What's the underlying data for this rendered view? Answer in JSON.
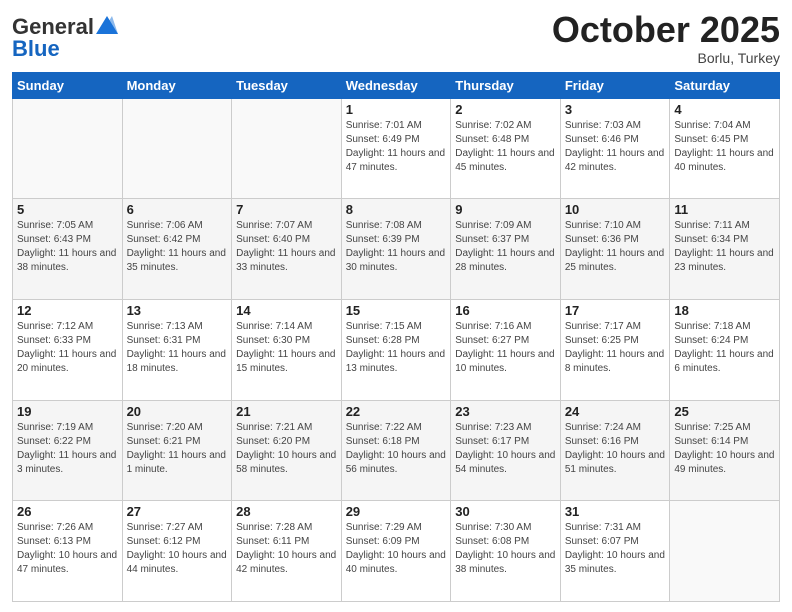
{
  "header": {
    "logo_general": "General",
    "logo_blue": "Blue",
    "month_title": "October 2025",
    "subtitle": "Borlu, Turkey"
  },
  "days_of_week": [
    "Sunday",
    "Monday",
    "Tuesday",
    "Wednesday",
    "Thursday",
    "Friday",
    "Saturday"
  ],
  "weeks": [
    [
      {
        "day": "",
        "info": ""
      },
      {
        "day": "",
        "info": ""
      },
      {
        "day": "",
        "info": ""
      },
      {
        "day": "1",
        "info": "Sunrise: 7:01 AM\nSunset: 6:49 PM\nDaylight: 11 hours and 47 minutes."
      },
      {
        "day": "2",
        "info": "Sunrise: 7:02 AM\nSunset: 6:48 PM\nDaylight: 11 hours and 45 minutes."
      },
      {
        "day": "3",
        "info": "Sunrise: 7:03 AM\nSunset: 6:46 PM\nDaylight: 11 hours and 42 minutes."
      },
      {
        "day": "4",
        "info": "Sunrise: 7:04 AM\nSunset: 6:45 PM\nDaylight: 11 hours and 40 minutes."
      }
    ],
    [
      {
        "day": "5",
        "info": "Sunrise: 7:05 AM\nSunset: 6:43 PM\nDaylight: 11 hours and 38 minutes."
      },
      {
        "day": "6",
        "info": "Sunrise: 7:06 AM\nSunset: 6:42 PM\nDaylight: 11 hours and 35 minutes."
      },
      {
        "day": "7",
        "info": "Sunrise: 7:07 AM\nSunset: 6:40 PM\nDaylight: 11 hours and 33 minutes."
      },
      {
        "day": "8",
        "info": "Sunrise: 7:08 AM\nSunset: 6:39 PM\nDaylight: 11 hours and 30 minutes."
      },
      {
        "day": "9",
        "info": "Sunrise: 7:09 AM\nSunset: 6:37 PM\nDaylight: 11 hours and 28 minutes."
      },
      {
        "day": "10",
        "info": "Sunrise: 7:10 AM\nSunset: 6:36 PM\nDaylight: 11 hours and 25 minutes."
      },
      {
        "day": "11",
        "info": "Sunrise: 7:11 AM\nSunset: 6:34 PM\nDaylight: 11 hours and 23 minutes."
      }
    ],
    [
      {
        "day": "12",
        "info": "Sunrise: 7:12 AM\nSunset: 6:33 PM\nDaylight: 11 hours and 20 minutes."
      },
      {
        "day": "13",
        "info": "Sunrise: 7:13 AM\nSunset: 6:31 PM\nDaylight: 11 hours and 18 minutes."
      },
      {
        "day": "14",
        "info": "Sunrise: 7:14 AM\nSunset: 6:30 PM\nDaylight: 11 hours and 15 minutes."
      },
      {
        "day": "15",
        "info": "Sunrise: 7:15 AM\nSunset: 6:28 PM\nDaylight: 11 hours and 13 minutes."
      },
      {
        "day": "16",
        "info": "Sunrise: 7:16 AM\nSunset: 6:27 PM\nDaylight: 11 hours and 10 minutes."
      },
      {
        "day": "17",
        "info": "Sunrise: 7:17 AM\nSunset: 6:25 PM\nDaylight: 11 hours and 8 minutes."
      },
      {
        "day": "18",
        "info": "Sunrise: 7:18 AM\nSunset: 6:24 PM\nDaylight: 11 hours and 6 minutes."
      }
    ],
    [
      {
        "day": "19",
        "info": "Sunrise: 7:19 AM\nSunset: 6:22 PM\nDaylight: 11 hours and 3 minutes."
      },
      {
        "day": "20",
        "info": "Sunrise: 7:20 AM\nSunset: 6:21 PM\nDaylight: 11 hours and 1 minute."
      },
      {
        "day": "21",
        "info": "Sunrise: 7:21 AM\nSunset: 6:20 PM\nDaylight: 10 hours and 58 minutes."
      },
      {
        "day": "22",
        "info": "Sunrise: 7:22 AM\nSunset: 6:18 PM\nDaylight: 10 hours and 56 minutes."
      },
      {
        "day": "23",
        "info": "Sunrise: 7:23 AM\nSunset: 6:17 PM\nDaylight: 10 hours and 54 minutes."
      },
      {
        "day": "24",
        "info": "Sunrise: 7:24 AM\nSunset: 6:16 PM\nDaylight: 10 hours and 51 minutes."
      },
      {
        "day": "25",
        "info": "Sunrise: 7:25 AM\nSunset: 6:14 PM\nDaylight: 10 hours and 49 minutes."
      }
    ],
    [
      {
        "day": "26",
        "info": "Sunrise: 7:26 AM\nSunset: 6:13 PM\nDaylight: 10 hours and 47 minutes."
      },
      {
        "day": "27",
        "info": "Sunrise: 7:27 AM\nSunset: 6:12 PM\nDaylight: 10 hours and 44 minutes."
      },
      {
        "day": "28",
        "info": "Sunrise: 7:28 AM\nSunset: 6:11 PM\nDaylight: 10 hours and 42 minutes."
      },
      {
        "day": "29",
        "info": "Sunrise: 7:29 AM\nSunset: 6:09 PM\nDaylight: 10 hours and 40 minutes."
      },
      {
        "day": "30",
        "info": "Sunrise: 7:30 AM\nSunset: 6:08 PM\nDaylight: 10 hours and 38 minutes."
      },
      {
        "day": "31",
        "info": "Sunrise: 7:31 AM\nSunset: 6:07 PM\nDaylight: 10 hours and 35 minutes."
      },
      {
        "day": "",
        "info": ""
      }
    ]
  ]
}
